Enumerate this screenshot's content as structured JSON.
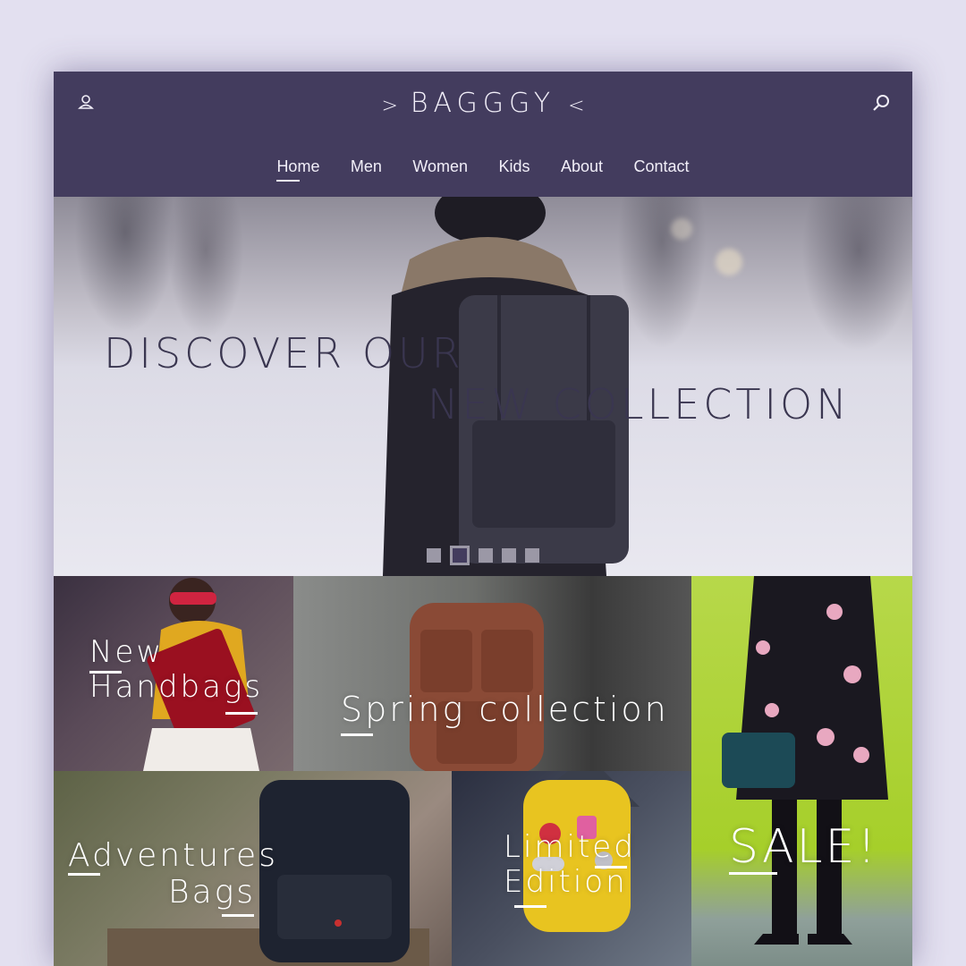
{
  "header": {
    "logo_left": ">",
    "logo_text": "BAGGGY",
    "logo_right": "<",
    "user_icon": "user-icon",
    "search_icon": "search-icon"
  },
  "nav": {
    "items": [
      {
        "label": "Home",
        "active": true
      },
      {
        "label": "Men"
      },
      {
        "label": "Women"
      },
      {
        "label": "Kids"
      },
      {
        "label": "About"
      },
      {
        "label": "Contact"
      }
    ]
  },
  "hero": {
    "line1": "DISCOVER OUR",
    "line2": "NEW COLLECTION",
    "slides": 5,
    "active_slide": 2
  },
  "tiles": {
    "new_handbags": {
      "line1": "New",
      "line2": "Handbags"
    },
    "spring": {
      "label": "Spring collection"
    },
    "sale": {
      "label": "SALE!"
    },
    "adventures": {
      "line1": "Adventures",
      "line2": "Bags"
    },
    "limited": {
      "line1": "Limited",
      "line2": "Edition"
    }
  },
  "colors": {
    "primary": "#433c5e",
    "background": "#e3e0f0",
    "sale_green": "#a6cf2a"
  }
}
